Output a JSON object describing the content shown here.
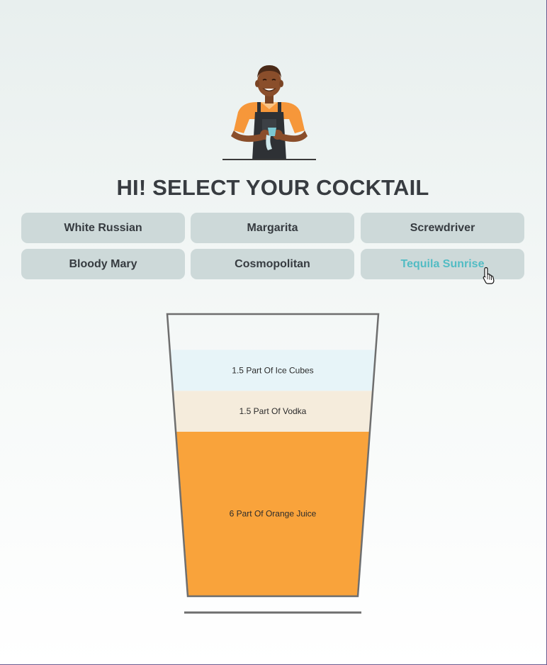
{
  "heading": "HI! SELECT YOUR COCKTAIL",
  "cocktails": [
    {
      "label": "White Russian",
      "active": false
    },
    {
      "label": "Margarita",
      "active": false
    },
    {
      "label": "Screwdriver",
      "active": false
    },
    {
      "label": "Bloody Mary",
      "active": false
    },
    {
      "label": "Cosmopolitan",
      "active": false
    },
    {
      "label": "Tequila Sunrise",
      "active": true
    }
  ],
  "glass": {
    "layers": [
      {
        "label": "1.5 Part Of Ice Cubes",
        "parts": 1.5,
        "color": "#e7f4f8"
      },
      {
        "label": "1.5 Part Of Vodka",
        "parts": 1.5,
        "color": "#f5ecdc"
      },
      {
        "label": "6 Part Of Orange Juice",
        "parts": 6,
        "color": "#f9a33b"
      }
    ]
  },
  "colors": {
    "button_bg": "#cdd9d9",
    "button_text": "#363b40",
    "active_text": "#52bcc4",
    "heading": "#383c41"
  },
  "icons": {
    "bartender": "bartender-illustration",
    "cursor": "hand-pointer-cursor"
  }
}
